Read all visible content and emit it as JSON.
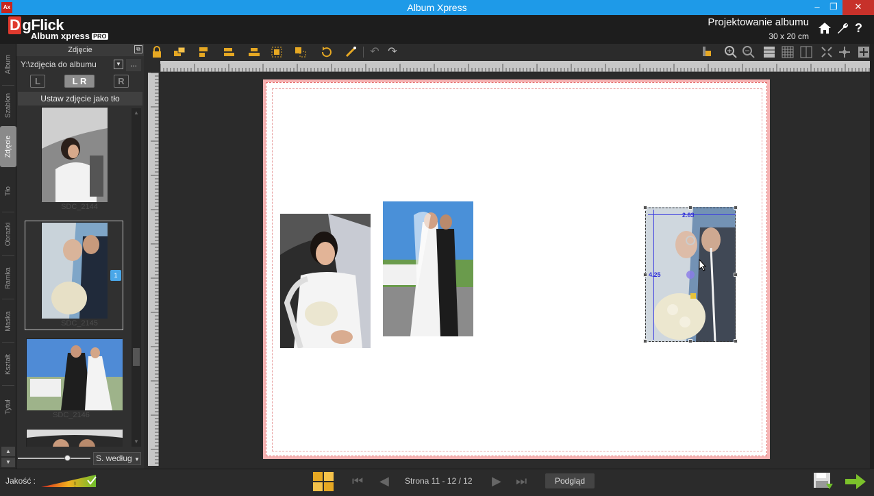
{
  "window": {
    "title": "Album Xpress",
    "app_icon": "Ax",
    "minimize": "–",
    "restore": "❐",
    "close": "✕"
  },
  "header": {
    "logo_d": "D",
    "logo_rest": "gFlick",
    "product": "Album xpress",
    "edition": "PRO",
    "mode_title": "Projektowanie albumu",
    "album_size": "30 x 20 cm",
    "icons": [
      "home-icon",
      "wrench-icon",
      "help-icon"
    ]
  },
  "vtabs": [
    {
      "label": "Album",
      "active": false
    },
    {
      "label": "Szablon",
      "active": false
    },
    {
      "label": "Zdjęcie",
      "active": true
    },
    {
      "label": "Tło",
      "active": false
    },
    {
      "label": "Obrazki",
      "active": false
    },
    {
      "label": "Ramka",
      "active": false
    },
    {
      "label": "Maska",
      "active": false
    },
    {
      "label": "Kształt",
      "active": false
    },
    {
      "label": "Tytuł",
      "active": false
    }
  ],
  "left_panel": {
    "title": "Zdjęcie",
    "path": "Y:\\zdjęcia do albumu",
    "more": "...",
    "buttons": [
      "L",
      "L R",
      "R"
    ],
    "set_background": "Ustaw zdjęcie jako tło",
    "thumbnails": [
      {
        "name": "SDC_2144",
        "selected": false
      },
      {
        "name": "SDC_2145",
        "selected": true,
        "badge": "1"
      },
      {
        "name": "SDC_2146",
        "selected": false
      },
      {
        "name": "",
        "selected": false
      }
    ],
    "sort": "S. według"
  },
  "toolbar": {
    "left_icons": [
      "lock-icon",
      "layers-icon",
      "align-icon",
      "align-left-icon",
      "align-center-icon",
      "group-icon",
      "ungroup-icon",
      "rotate-icon",
      "crop-icon",
      "undo-icon",
      "redo-icon"
    ],
    "right_icons": [
      "snap-icon",
      "zoom-in-icon",
      "zoom-out-icon",
      "grid-icon",
      "grid-small-icon",
      "columns-icon",
      "fit-icon",
      "move-icon",
      "fullscreen-icon"
    ]
  },
  "canvas": {
    "selection": {
      "width_label": "2.83",
      "height_label": "4.25"
    }
  },
  "statusbar": {
    "quality_label": "Jakość :",
    "page_label": "Strona 11 - 12 / 12",
    "preview": "Podgląd"
  },
  "colors": {
    "titlebar": "#1e9ae8",
    "accent": "#e6a823",
    "page_border": "#f6b3b3",
    "guide": "#3a3ae0",
    "next_arrow": "#7cc22b"
  }
}
